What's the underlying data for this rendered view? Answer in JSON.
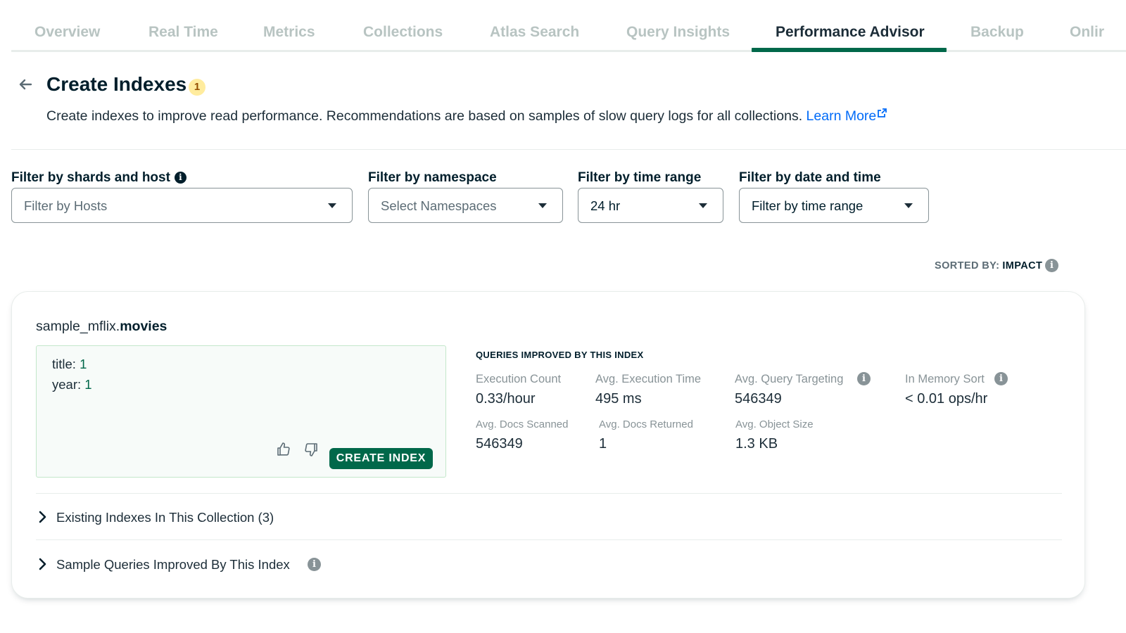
{
  "tabs": [
    {
      "label": "Overview",
      "active": false
    },
    {
      "label": "Real Time",
      "active": false
    },
    {
      "label": "Metrics",
      "active": false
    },
    {
      "label": "Collections",
      "active": false
    },
    {
      "label": "Atlas Search",
      "active": false
    },
    {
      "label": "Query Insights",
      "active": false
    },
    {
      "label": "Performance Advisor",
      "active": true
    },
    {
      "label": "Backup",
      "active": false
    },
    {
      "label": "Onlir",
      "active": false
    }
  ],
  "header": {
    "title": "Create Indexes",
    "badge_count": "1",
    "subtitle": "Create indexes to improve read performance. Recommendations are based on samples of slow query logs for all collections.",
    "learn_more": "Learn More"
  },
  "filters": [
    {
      "label": "Filter by shards and host",
      "value": "Filter by Hosts",
      "is_placeholder": true
    },
    {
      "label": "Filter by namespace",
      "value": "Select Namespaces",
      "is_placeholder": true
    },
    {
      "label": "Filter by time range",
      "value": "24 hr",
      "is_placeholder": false
    },
    {
      "label": "Filter by date and time",
      "value": "Filter by time range",
      "is_placeholder": false
    }
  ],
  "sort": {
    "label": "SORTED BY:",
    "value": "IMPACT"
  },
  "recommendation": {
    "namespace_db": "sample_mflix.",
    "namespace_coll": "movies",
    "index_fields": [
      {
        "field": "title:",
        "value": "1"
      },
      {
        "field": "year:",
        "value": "1"
      }
    ],
    "create_button": "CREATE INDEX",
    "stats_heading": "QUERIES IMPROVED BY THIS INDEX",
    "stats": {
      "execution_count": {
        "label": "Execution Count",
        "value": "0.33/hour"
      },
      "avg_execution_time": {
        "label": "Avg. Execution Time",
        "value": "495 ms"
      },
      "avg_query_targeting": {
        "label": "Avg. Query Targeting",
        "value": "546349"
      },
      "in_memory_sort": {
        "label": "In Memory Sort",
        "value": "< 0.01 ops/hr"
      },
      "avg_docs_scanned": {
        "label": "Avg. Docs Scanned",
        "value": "546349"
      },
      "avg_docs_returned": {
        "label": "Avg. Docs Returned",
        "value": "1"
      },
      "avg_object_size": {
        "label": "Avg. Object Size",
        "value": "1.3 KB"
      }
    },
    "existing_indexes": "Existing Indexes In This Collection (3)",
    "sample_queries": "Sample Queries Improved By This Index"
  },
  "icons": {
    "info": "i"
  },
  "colors": {
    "brand_green": "#00684a",
    "link_blue": "#016bf8",
    "badge_yellow": "#ffec9e"
  }
}
